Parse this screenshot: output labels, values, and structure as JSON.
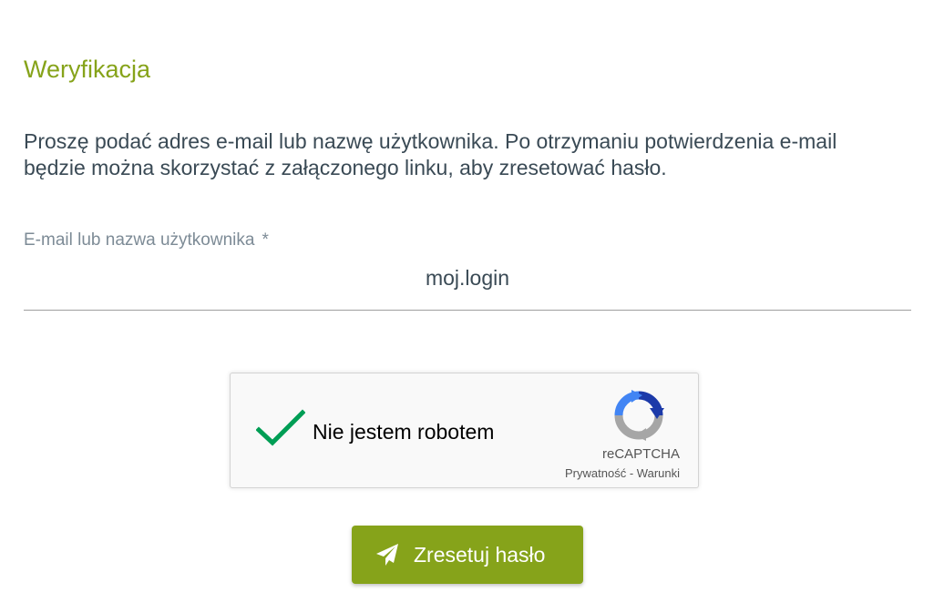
{
  "section": {
    "title": "Weryfikacja",
    "description": "Proszę podać adres e-mail lub nazwę użytkownika. Po otrzymaniu potwierdzenia e-mail będzie można skorzystać z załączonego linku, aby zresetować hasło."
  },
  "form": {
    "field_label": "E-mail lub nazwa użytkownika",
    "required_marker": "*",
    "field_value": "moj.login"
  },
  "recaptcha": {
    "label": "Nie jestem robotem",
    "checked": true,
    "brand": "reCAPTCHA",
    "privacy_link": "Prywatność",
    "separator": "-",
    "terms_link": "Warunki",
    "check_icon": "checkmark-icon",
    "logo_icon": "recaptcha-logo-icon"
  },
  "submit": {
    "label": "Zresetuj hasło",
    "icon": "paper-plane-icon"
  },
  "colors": {
    "accent": "#86a31a",
    "text": "#3a4a55",
    "label": "#7d8b96",
    "check": "#009e55"
  }
}
